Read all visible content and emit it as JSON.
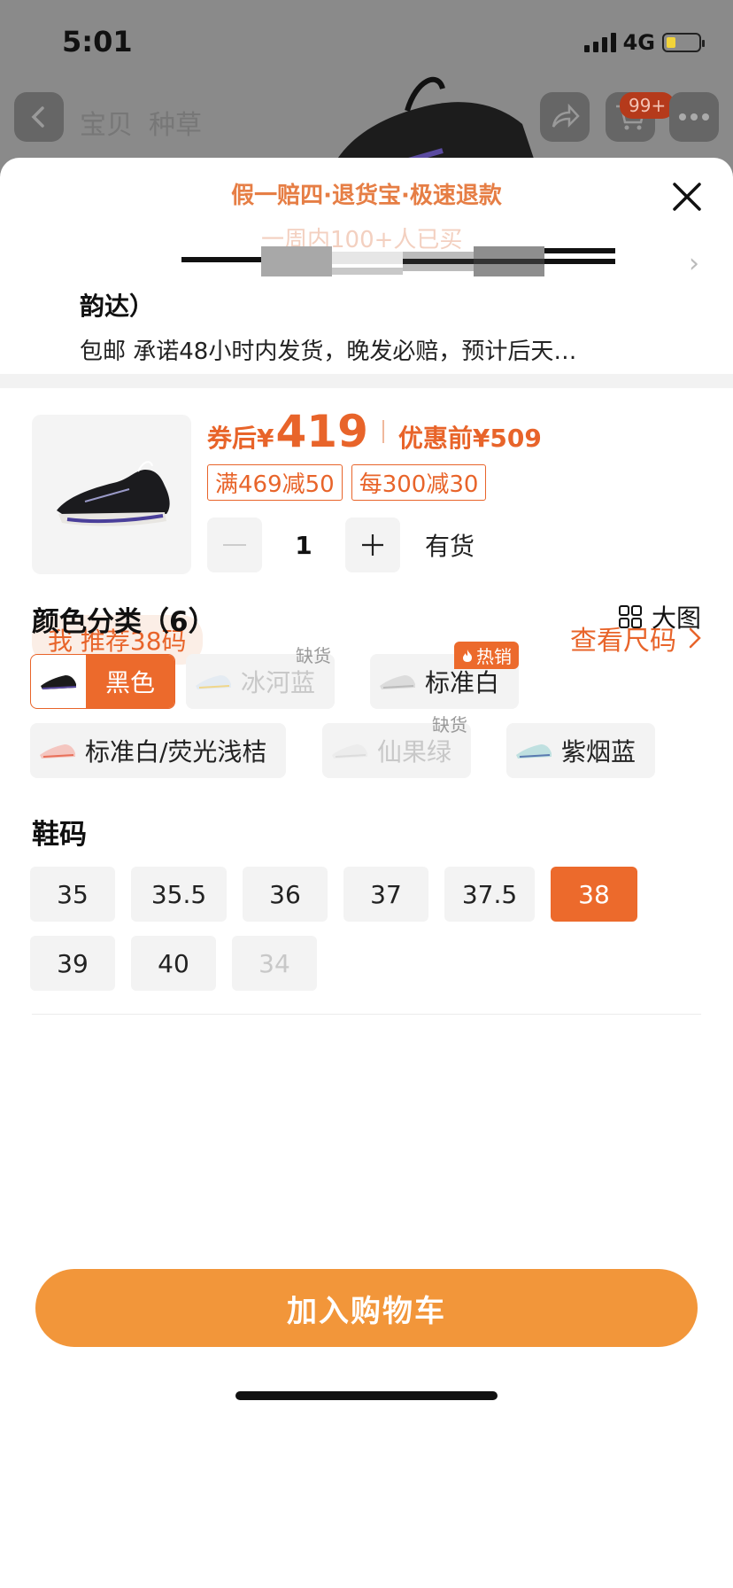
{
  "status": {
    "time": "5:01",
    "network": "4G"
  },
  "background_page": {
    "tab_goods": "宝贝",
    "tab_grass": "种草",
    "cart_badge": "99+"
  },
  "sheet": {
    "guarantee": "假一赔四·退货宝·极速退款",
    "buyers_note": "一周内100+人已买",
    "courier": "韵达）",
    "shipping_note": "包邮 承诺48小时内发货，晚发必赔，预计后天…"
  },
  "product": {
    "price_label": "券后",
    "currency": "¥",
    "price": "419",
    "orig_label": "优惠前",
    "orig_price": "509",
    "coupons": [
      "满469减50",
      "每300减30"
    ],
    "quantity": "1",
    "stock": "有货"
  },
  "recommend": "我 推荐38码",
  "size_chart_link": "查看尺码",
  "color_section": {
    "title": "颜色分类（6）",
    "big_view": "大图",
    "options": [
      {
        "label": "黑色",
        "state": "selected"
      },
      {
        "label": "冰河蓝",
        "state": "disabled",
        "tag": "缺货"
      },
      {
        "label": "标准白",
        "state": "normal",
        "tag": "热销"
      },
      {
        "label": "标准白/荧光浅桔",
        "state": "normal"
      },
      {
        "label": "仙果绿",
        "state": "disabled",
        "tag": "缺货"
      },
      {
        "label": "紫烟蓝",
        "state": "normal"
      }
    ]
  },
  "size_section": {
    "title": "鞋码",
    "sizes": [
      "35",
      "35.5",
      "36",
      "37",
      "37.5",
      "38",
      "39",
      "40",
      "34"
    ],
    "selected": "38",
    "disabled": [
      "34"
    ]
  },
  "add_to_cart": "加入购物车",
  "colors": {
    "accent": "#ec6a2c",
    "cart_button": "#f2963a"
  }
}
